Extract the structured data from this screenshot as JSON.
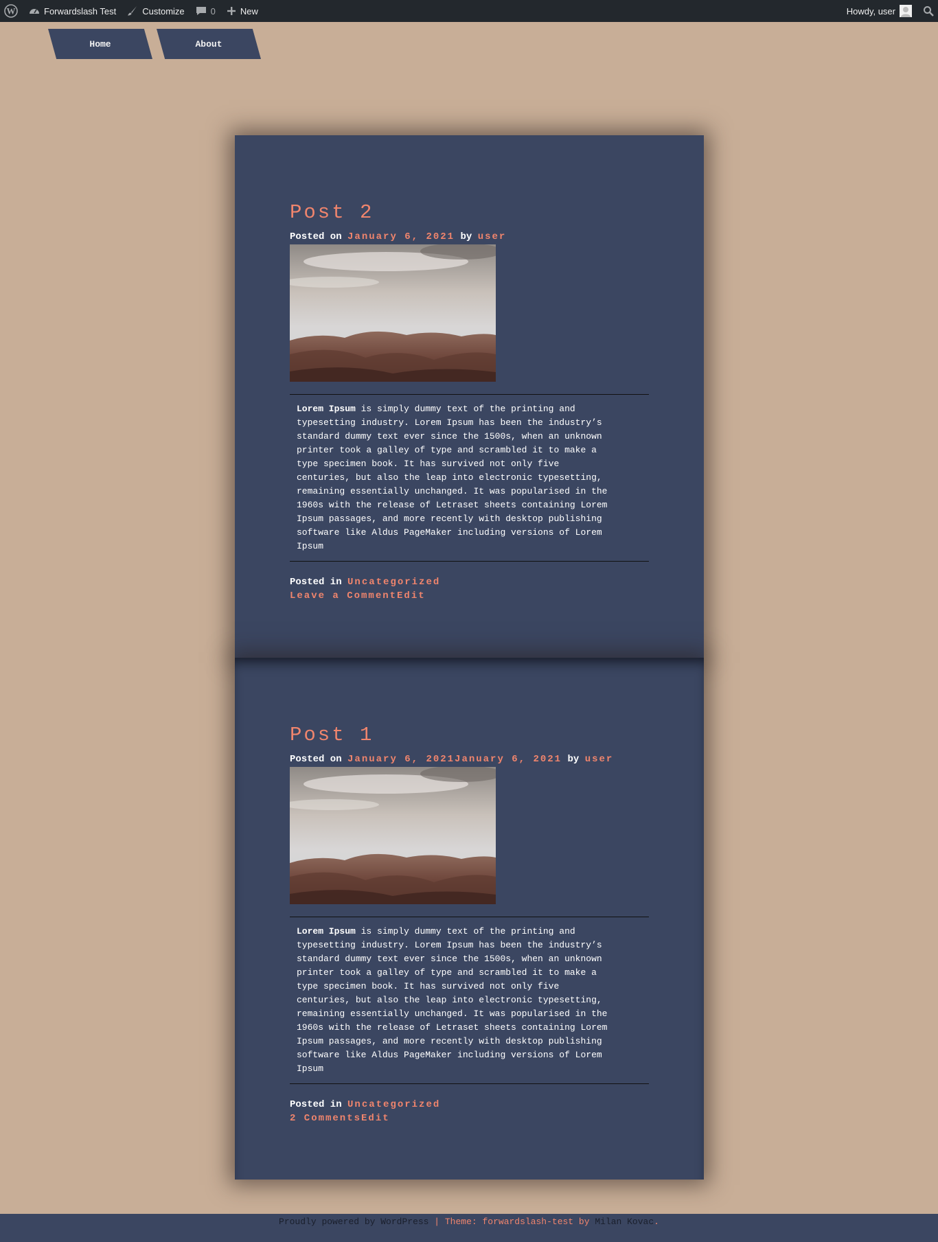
{
  "adminbar": {
    "site_name": "Forwardslash Test",
    "customize": "Customize",
    "comments_count": "0",
    "new_label": "New",
    "howdy": "Howdy, user"
  },
  "nav": {
    "items": [
      {
        "label": "Home"
      },
      {
        "label": "About"
      }
    ]
  },
  "posts": [
    {
      "title": "Post 2",
      "posted_on_label": "Posted on",
      "date": "January 6, 2021",
      "by_label": "by",
      "author": "user",
      "excerpt_bold": "Lorem Ipsum",
      "excerpt_lines": [
        " is simply dummy text of the printing and",
        "typesetting industry. Lorem Ipsum has been the industry’s",
        "standard dummy text ever since the 1500s, when an unknown",
        "printer took a galley of type and scrambled it to make a",
        "type specimen book. It has survived not only five",
        "centuries, but also the leap into electronic typesetting,",
        "remaining essentially unchanged. It was popularised in the",
        "1960s with the release of Letraset sheets containing Lorem",
        "Ipsum passages, and more recently with desktop publishing",
        "software like Aldus PageMaker including versions of Lorem",
        "Ipsum"
      ],
      "posted_in_label": "Posted in",
      "category": "Uncategorized",
      "comments_link": "Leave a Comment",
      "edit_link": "Edit"
    },
    {
      "title": "Post 1",
      "posted_on_label": "Posted on",
      "date": "January 6, 2021January 6, 2021",
      "by_label": "by",
      "author": "user",
      "excerpt_bold": "Lorem Ipsum",
      "excerpt_lines": [
        " is simply dummy text of the printing and",
        "typesetting industry. Lorem Ipsum has been the industry’s",
        "standard dummy text ever since the 1500s, when an unknown",
        "printer took a galley of type and scrambled it to make a",
        "type specimen book. It has survived not only five",
        "centuries, but also the leap into electronic typesetting,",
        "remaining essentially unchanged. It was popularised in the",
        "1960s with the release of Letraset sheets containing Lorem",
        "Ipsum passages, and more recently with desktop publishing",
        "software like Aldus PageMaker including versions of Lorem",
        "Ipsum"
      ],
      "posted_in_label": "Posted in",
      "category": "Uncategorized",
      "comments_link": "2 Comments",
      "edit_link": "Edit"
    }
  ],
  "footer": {
    "powered": "Proudly powered by WordPress",
    "sep": " | ",
    "theme_label": "Theme: forwardslash-test by ",
    "author": "Milan Kovac",
    "end": "."
  },
  "colors": {
    "background": "#c8ae97",
    "panel": "#3b4661",
    "accent": "#f0856d",
    "adminbar": "#23282d"
  }
}
